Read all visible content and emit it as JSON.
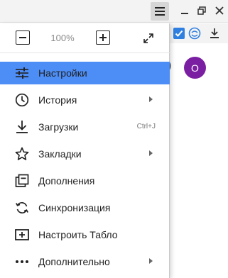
{
  "menu": {
    "zoom": {
      "minus_label": "−",
      "value": "100%",
      "plus_label": "+"
    },
    "items": [
      {
        "label": "Настройки",
        "icon": "settings-sliders-icon",
        "active": true
      },
      {
        "label": "История",
        "icon": "clock-icon",
        "submenu": true
      },
      {
        "label": "Загрузки",
        "icon": "download-icon",
        "shortcut": "Ctrl+J"
      },
      {
        "label": "Закладки",
        "icon": "star-icon",
        "submenu": true
      },
      {
        "label": "Дополнения",
        "icon": "addons-icon"
      },
      {
        "label": "Синхронизация",
        "icon": "sync-icon"
      },
      {
        "label": "Настроить Табло",
        "icon": "add-tab-icon"
      },
      {
        "label": "Дополнительно",
        "icon": "more-dots-icon",
        "submenu": true
      }
    ]
  },
  "avatar": {
    "initial": "O",
    "color": "#7b1fa2"
  },
  "colors": {
    "active_bg": "#4c8df6",
    "toolbar_accent": "#2f7fe0"
  }
}
